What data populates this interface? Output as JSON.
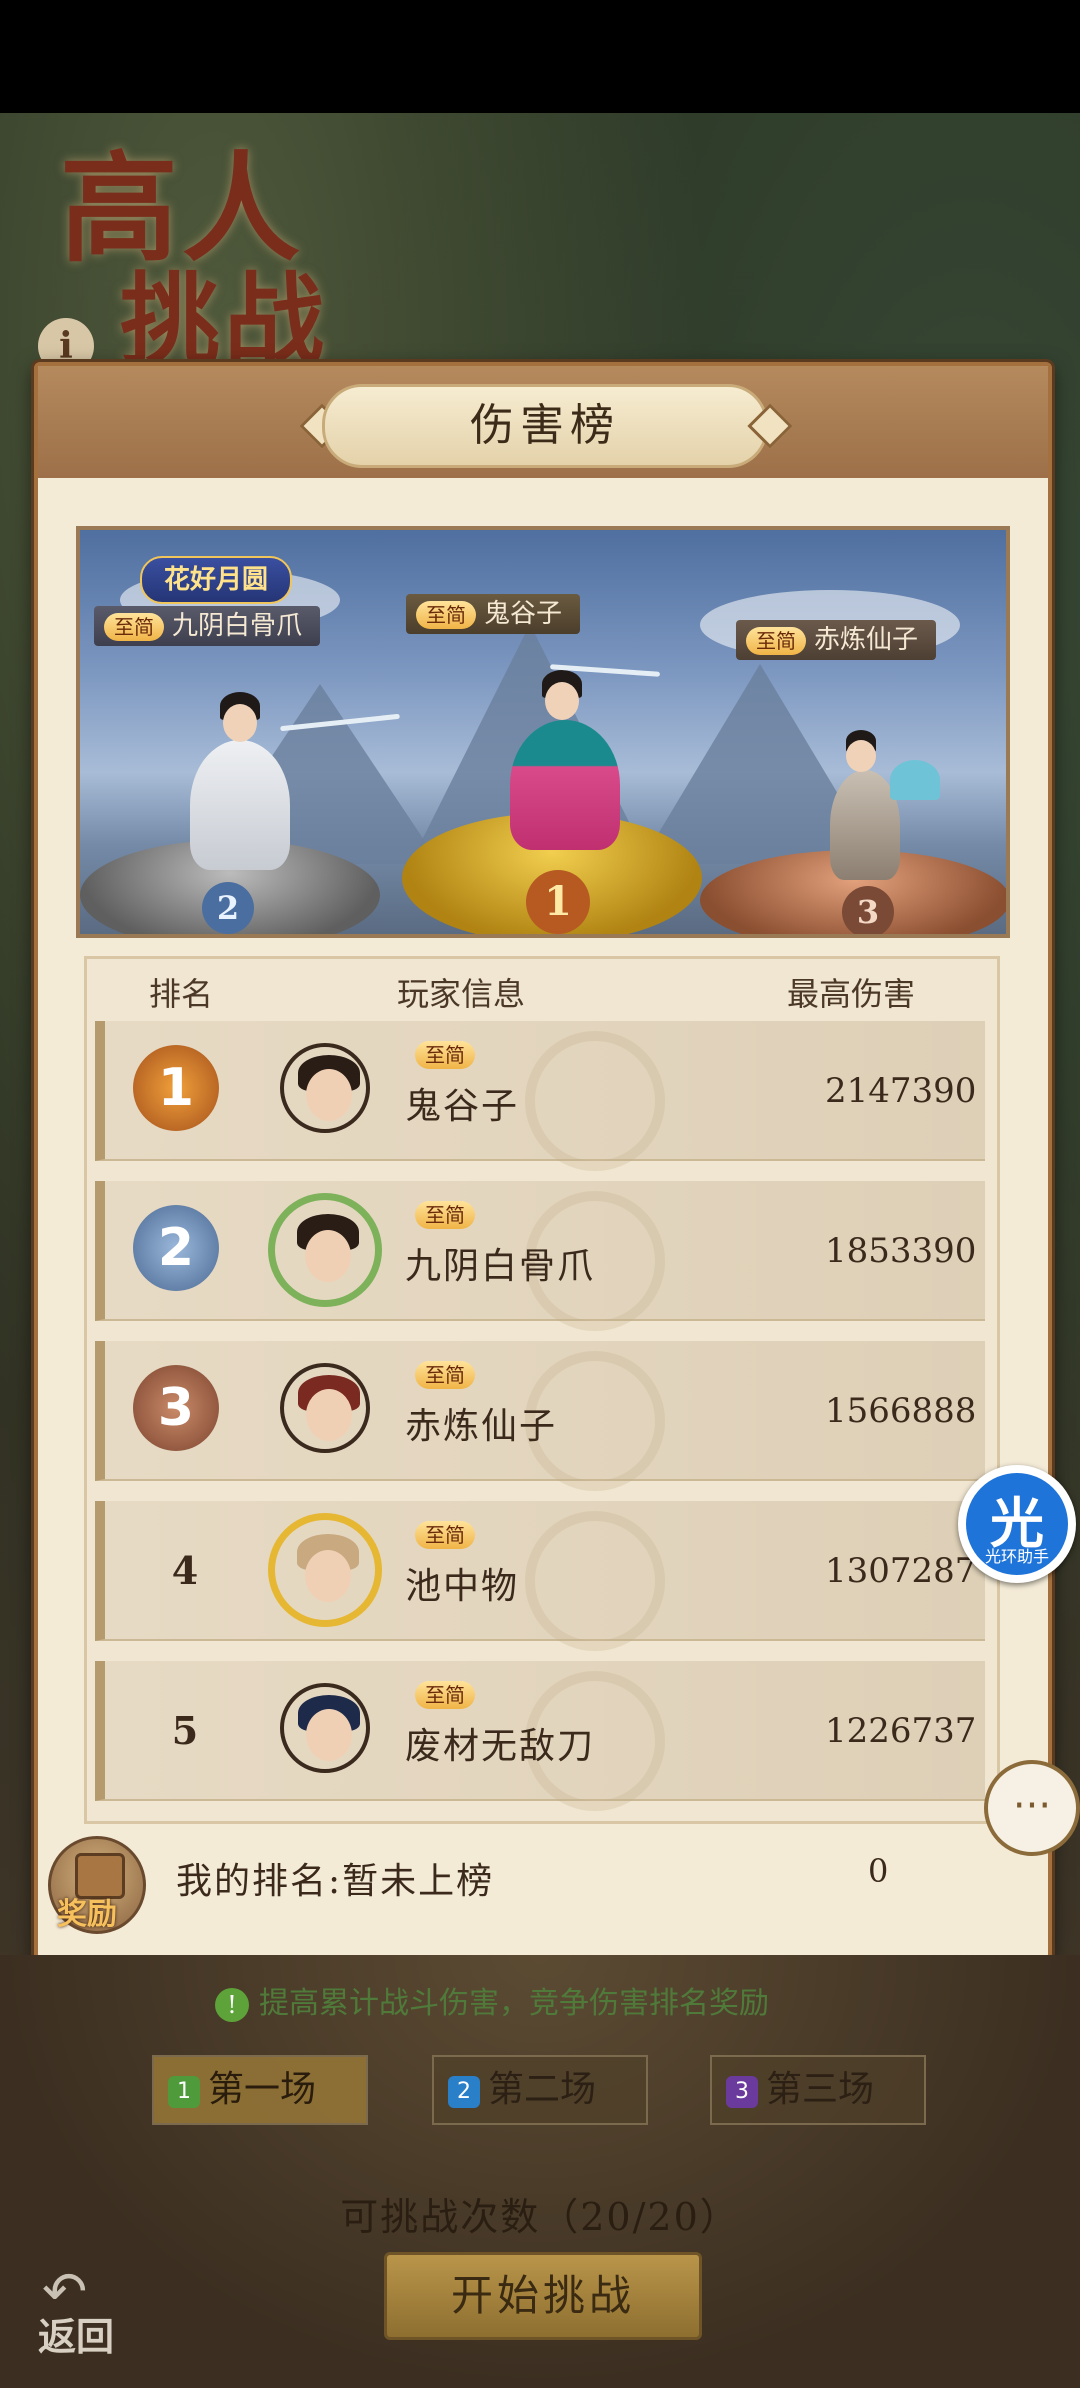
{
  "header": {
    "game_title_line1": "高人",
    "game_title_line2": "挑战",
    "info_icon": "i"
  },
  "panel": {
    "title": "伤害榜"
  },
  "podium": {
    "event_badge": "花好月圆",
    "first": {
      "vip": "至简",
      "name": "鬼谷子",
      "rank": "1"
    },
    "second": {
      "vip": "至简",
      "name": "九阴白骨爪",
      "rank": "2"
    },
    "third": {
      "vip": "至简",
      "name": "赤炼仙子",
      "rank": "3"
    }
  },
  "table": {
    "headers": {
      "rank": "排名",
      "player": "玩家信息",
      "damage": "最高伤害"
    },
    "rows": [
      {
        "rank": "1",
        "vip": "至简",
        "name": "鬼谷子",
        "damage": "2147390"
      },
      {
        "rank": "2",
        "vip": "至简",
        "name": "九阴白骨爪",
        "damage": "1853390"
      },
      {
        "rank": "3",
        "vip": "至简",
        "name": "赤炼仙子",
        "damage": "1566888"
      },
      {
        "rank": "4",
        "vip": "至简",
        "name": "池中物",
        "damage": "1307287"
      },
      {
        "rank": "5",
        "vip": "至简",
        "name": "废材无敌刀",
        "damage": "1226737"
      }
    ]
  },
  "my_rank": {
    "reward_label": "奖励",
    "text": "我的排名:暂未上榜",
    "value": "0"
  },
  "tip": {
    "icon": "!",
    "text": "提高累计战斗伤害，竞争伤害排名奖励"
  },
  "rounds": [
    {
      "num": "1",
      "label": "第一场",
      "color": "#4f9a3a"
    },
    {
      "num": "2",
      "label": "第二场",
      "color": "#2a7fc9"
    },
    {
      "num": "3",
      "label": "第三场",
      "color": "#6a3a9c"
    }
  ],
  "attempts": "可挑战次数（20/20）",
  "start_button": "开始挑战",
  "back_button": "返回",
  "float_help": {
    "glyph": "光",
    "label": "光环助手"
  },
  "chat_icon": "···",
  "colors": {
    "gold": "#d7a23a",
    "silver": "#6f8fb5",
    "bronze": "#9a5a3c"
  }
}
